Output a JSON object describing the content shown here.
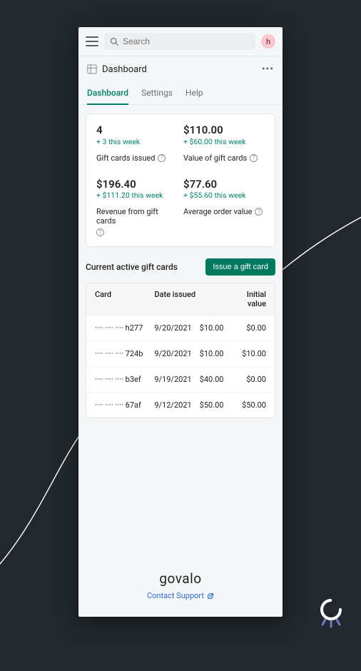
{
  "topbar": {
    "search_placeholder": "Search",
    "avatar_initial": "h"
  },
  "page": {
    "title": "Dashboard"
  },
  "tabs": [
    {
      "label": "Dashboard",
      "active": true
    },
    {
      "label": "Settings",
      "active": false
    },
    {
      "label": "Help",
      "active": false
    }
  ],
  "stats": {
    "issued": {
      "value": "4",
      "delta": "+ 3 this week",
      "label": "Gift cards issued"
    },
    "value": {
      "value": "$110.00",
      "delta": "+ $60.00 this week",
      "label": "Value of gift cards"
    },
    "revenue": {
      "value": "$196.40",
      "delta": "+ $111.20 this week",
      "label": "Revenue from gift cards"
    },
    "avg_order": {
      "value": "$77.60",
      "delta": "+ $55.60 this week",
      "label": "Average order value"
    }
  },
  "active_cards": {
    "section_title": "Current active gift cards",
    "issue_button": "Issue a gift card",
    "columns": {
      "card": "Card",
      "date": "Date issued",
      "initial": "Initial value"
    },
    "rows": [
      {
        "card": "···· ···· ···· h277",
        "date": "9/20/2021",
        "amount": "$10.00",
        "initial": "$0.00"
      },
      {
        "card": "···· ···· ···· 724b",
        "date": "9/20/2021",
        "amount": "$10.00",
        "initial": "$10.00"
      },
      {
        "card": "···· ···· ···· b3ef",
        "date": "9/19/2021",
        "amount": "$40.00",
        "initial": "$0.00"
      },
      {
        "card": "···· ···· ···· 67af",
        "date": "9/12/2021",
        "amount": "$50.00",
        "initial": "$50.00"
      }
    ]
  },
  "footer": {
    "brand": "govalo",
    "support_label": "Contact Support"
  }
}
